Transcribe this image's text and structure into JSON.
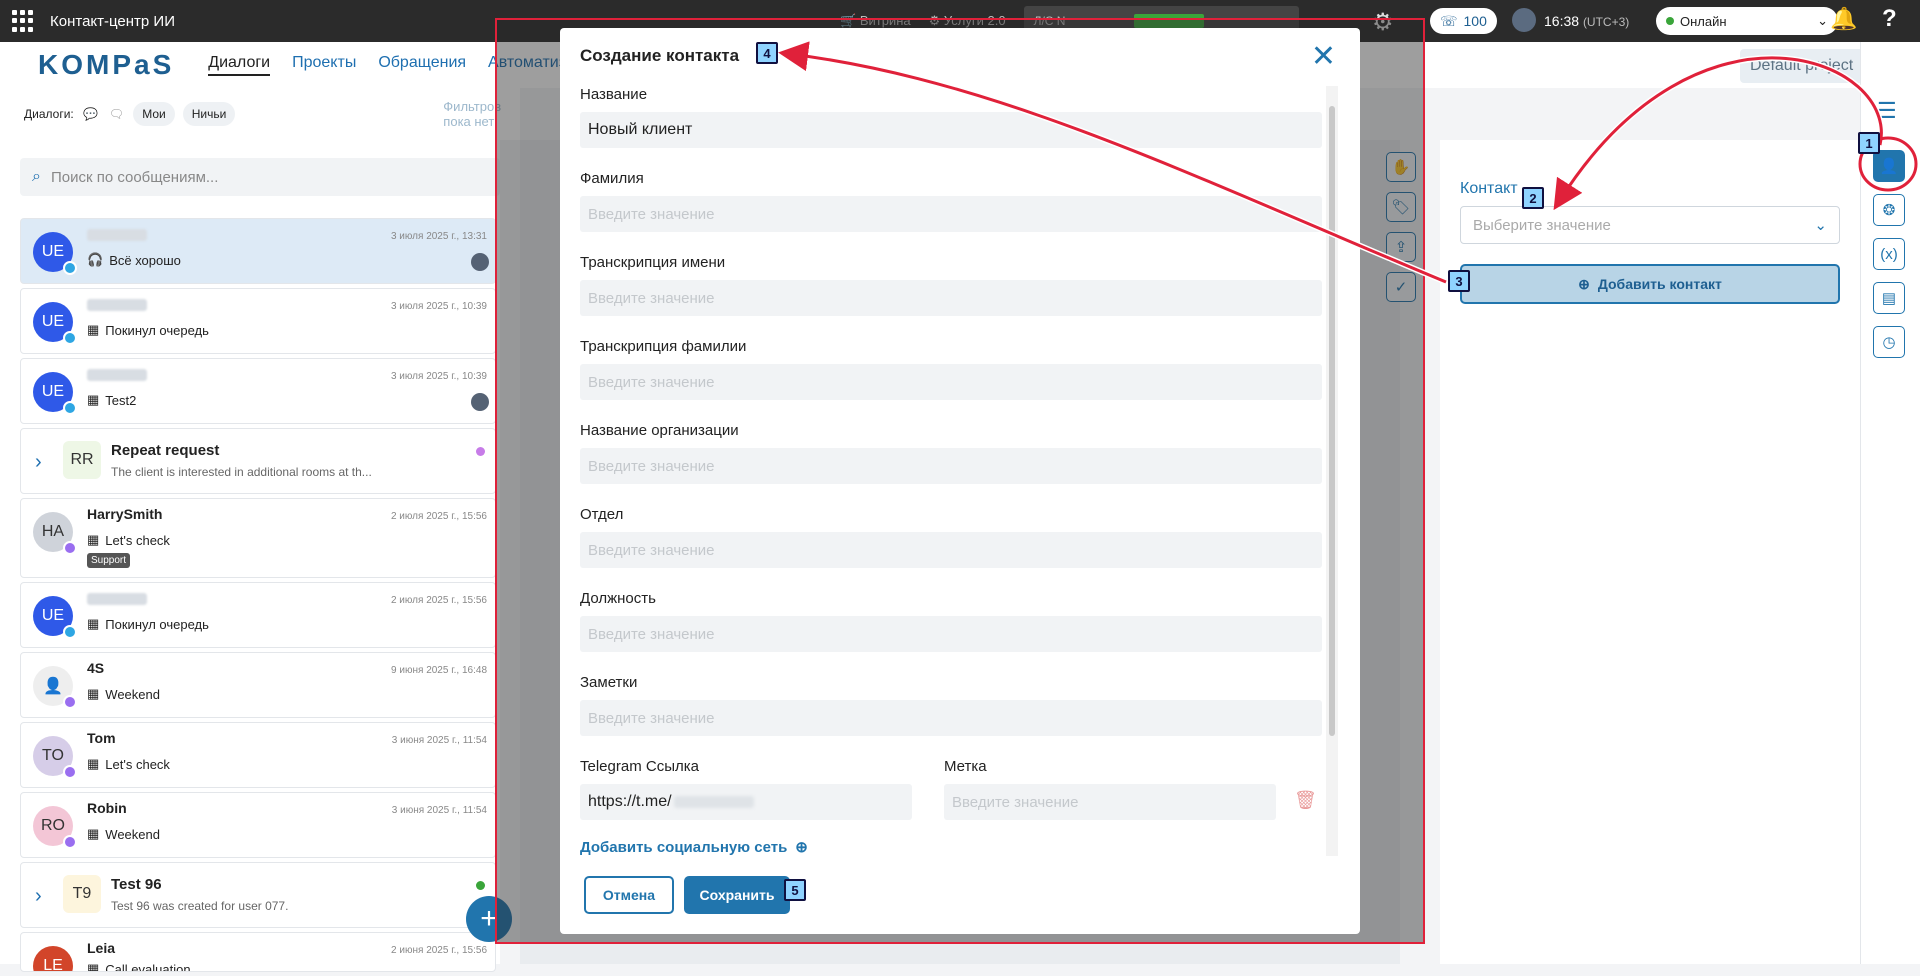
{
  "app": {
    "title": "Контакт-центр ИИ"
  },
  "topbar": {
    "items": [
      "Витрина",
      "Услуги 2.0",
      "Л/С N"
    ],
    "phone_count": "100",
    "time": "16:38",
    "tz": "(UTC+3)",
    "status": "Онлайн"
  },
  "header": {
    "logo": "KOMPaS",
    "nav": [
      "Диалоги",
      "Проекты",
      "Обращения",
      "Автоматизац"
    ],
    "project": "Default project"
  },
  "filters": {
    "label": "Диалоги:",
    "chips": [
      "Мои",
      "Ничьи"
    ],
    "hint": "Фильтров пока нет"
  },
  "search": {
    "placeholder": "Поиск по сообщениям..."
  },
  "dialogs": [
    {
      "initials": "UE",
      "date": "3 июля 2025 г., 13:31",
      "last": "Всё хорошо"
    },
    {
      "initials": "UE",
      "date": "3 июля 2025 г., 10:39",
      "last": "Покинул очередь"
    },
    {
      "initials": "UE",
      "date": "3 июля 2025 г., 10:39",
      "last": "Test2"
    },
    {
      "initials": "RR",
      "name": "Repeat request",
      "sub": "The client is interested in additional rooms at th..."
    },
    {
      "initials": "HA",
      "name": "HarrySmith",
      "date": "2 июля 2025 г., 15:56",
      "last": "Let's check",
      "tag": "Support"
    },
    {
      "initials": "UE",
      "date": "2 июля 2025 г., 15:56",
      "last": "Покинул очередь"
    },
    {
      "initials": "",
      "name": "4S",
      "date": "9 июня 2025 г., 16:48",
      "last": "Weekend"
    },
    {
      "initials": "TO",
      "name": "Tom",
      "date": "3 июня 2025 г., 11:54",
      "last": "Let's check"
    },
    {
      "initials": "RO",
      "name": "Robin",
      "date": "3 июня 2025 г., 11:54",
      "last": "Weekend"
    },
    {
      "initials": "T9",
      "name": "Test 96",
      "sub": "Test 96 was created for user 077."
    },
    {
      "initials": "LE",
      "name": "Leia",
      "date": "2 июня 2025 г., 15:56",
      "last": "Call evaluation"
    }
  ],
  "contact_panel": {
    "label": "Контакт",
    "placeholder": "Выберите значение",
    "add_button": "Добавить контакт"
  },
  "modal": {
    "title": "Создание контакта",
    "fields": [
      {
        "label": "Название",
        "value": "Новый клиент"
      },
      {
        "label": "Фамилия",
        "placeholder": "Введите значение"
      },
      {
        "label": "Транскрипция имени",
        "placeholder": "Введите значение"
      },
      {
        "label": "Транскрипция фамилии",
        "placeholder": "Введите значение"
      },
      {
        "label": "Название организации",
        "placeholder": "Введите значение"
      },
      {
        "label": "Отдел",
        "placeholder": "Введите значение"
      },
      {
        "label": "Должность",
        "placeholder": "Введите значение"
      },
      {
        "label": "Заметки",
        "placeholder": "Введите значение"
      }
    ],
    "telegram_label": "Telegram Ссылка",
    "telegram_value": "https://t.me/",
    "tag_label": "Метка",
    "tag_placeholder": "Введите значение",
    "add_social": "Добавить социальную сеть",
    "cancel": "Отмена",
    "save": "Сохранить"
  },
  "annotations": [
    "1",
    "2",
    "3",
    "4",
    "5"
  ],
  "colors": {
    "accent": "#2175ad",
    "highlight": "#e0213a",
    "marker": "#8fd3ff"
  }
}
